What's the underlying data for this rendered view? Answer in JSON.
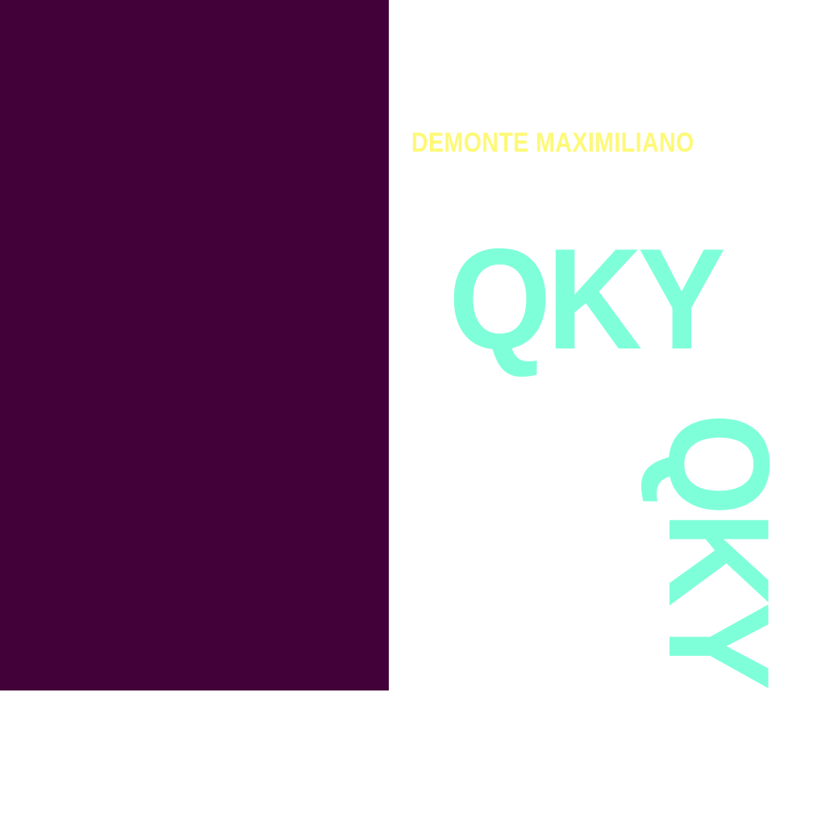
{
  "colors": {
    "panel": "#420239",
    "name": "#fdf977",
    "mark": "#7fffd9",
    "background": "#ffffff"
  },
  "brand": {
    "name": "DEMONTE MAXIMILIANO",
    "mark": "QKY"
  }
}
